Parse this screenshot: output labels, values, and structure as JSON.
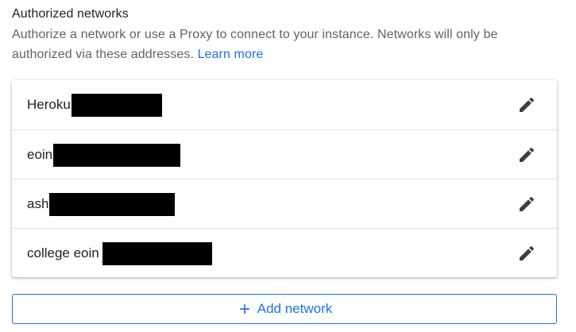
{
  "section": {
    "title": "Authorized networks",
    "description": "Authorize a network or use a Proxy to connect to your instance. Networks will only be authorized via these addresses.",
    "learn_more": "Learn more"
  },
  "networks": [
    {
      "name": "Heroku",
      "redacted_width": 114
    },
    {
      "name": "eoin",
      "redacted_width": 160
    },
    {
      "name": "ash",
      "redacted_width": 158
    },
    {
      "name": "college eoin",
      "redacted_width": 138
    }
  ],
  "add_button": {
    "label": "Add network"
  },
  "colors": {
    "accent": "#1a73e8",
    "text": "#202124",
    "secondary_text": "#5f6368",
    "redaction": "#000000"
  },
  "icons": {
    "edit": "pencil-edit-icon",
    "add": "plus-icon"
  }
}
